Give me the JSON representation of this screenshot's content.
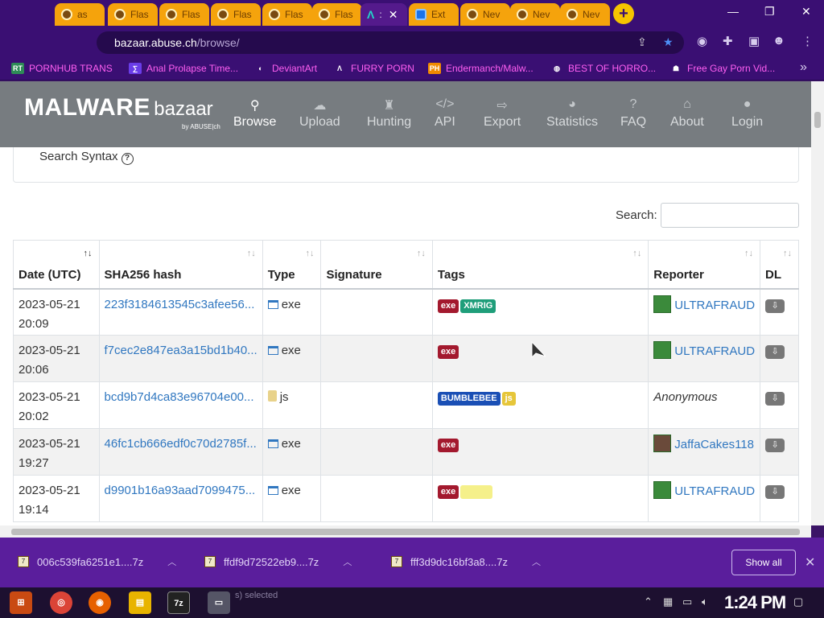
{
  "browser": {
    "tabs": [
      {
        "label": "as",
        "type": "flash"
      },
      {
        "label": "Flas",
        "type": "flash"
      },
      {
        "label": "Flas",
        "type": "flash"
      },
      {
        "label": "Flas",
        "type": "flash"
      },
      {
        "label": "Flas",
        "type": "flash"
      },
      {
        "label": "Flas",
        "type": "flash"
      },
      {
        "label": ":",
        "type": "active",
        "icon": "Λ"
      },
      {
        "label": "Ext",
        "type": "extension"
      },
      {
        "label": "Nev",
        "type": "newtab"
      },
      {
        "label": "Nev",
        "type": "newtab"
      },
      {
        "label": "Nev",
        "type": "newtab"
      }
    ],
    "url_domain": "bazaar.abuse.ch",
    "url_path": "/browse/",
    "bookmarks": [
      {
        "icon": "RT",
        "label": "PORNHUB TRANS",
        "icon_color": "#2e8b57"
      },
      {
        "icon": "∑",
        "label": "Anal Prolapse Time...",
        "icon_color": "#6a3de8"
      },
      {
        "icon": "◐",
        "label": "DeviantArt",
        "icon_color": "#3a0f73"
      },
      {
        "icon": "Λ",
        "label": "FURRY PORN",
        "icon_color": "#3a0f73"
      },
      {
        "icon": "PH",
        "label": "Endermanch/Malw...",
        "icon_color": "#f08a00"
      },
      {
        "icon": "◍",
        "label": "BEST OF HORRO...",
        "icon_color": "#3a0f73"
      },
      {
        "icon": "☗",
        "label": "Free Gay Porn Vid...",
        "icon_color": "#3a0f73"
      }
    ]
  },
  "site": {
    "logo_main": "MALWARE",
    "logo_sub": "bazaar",
    "logo_by": "by ABUSE|ch",
    "nav": [
      {
        "label": "Browse",
        "icon": "search-icon",
        "glyph": "⚲",
        "active": true
      },
      {
        "label": "Upload",
        "icon": "upload-icon",
        "glyph": "☁",
        "active": false
      },
      {
        "label": "Hunting",
        "icon": "hunting-icon",
        "glyph": "♜",
        "active": false
      },
      {
        "label": "API",
        "icon": "code-icon",
        "glyph": "</>",
        "active": false
      },
      {
        "label": "Export",
        "icon": "export-icon",
        "glyph": "⇨",
        "active": false
      },
      {
        "label": "Statistics",
        "icon": "chart-pie-icon",
        "glyph": "◕",
        "active": false
      },
      {
        "label": "FAQ",
        "icon": "question-icon",
        "glyph": "?",
        "active": false
      },
      {
        "label": "About",
        "icon": "building-icon",
        "glyph": "⌂",
        "active": false
      },
      {
        "label": "Login",
        "icon": "user-icon",
        "glyph": "●",
        "active": false
      }
    ],
    "search_syntax": "Search Syntax",
    "search_label": "Search:",
    "search_value": ""
  },
  "table": {
    "headers": [
      "Date (UTC)",
      "SHA256 hash",
      "Type",
      "Signature",
      "Tags",
      "Reporter",
      "DL"
    ],
    "rows": [
      {
        "date": "2023-05-21",
        "time": "20:09",
        "hash": "223f3184613545c3afee56...",
        "type": "exe",
        "signature": "",
        "tags": [
          {
            "text": "exe",
            "color": "#a3192e"
          },
          {
            "text": "XMRIG",
            "color": "#1f9e7a"
          }
        ],
        "reporter": "ULTRAFRAUD",
        "avatar": "green"
      },
      {
        "date": "2023-05-21",
        "time": "20:06",
        "hash": "f7cec2e847ea3a15bd1b40...",
        "type": "exe",
        "signature": "",
        "tags": [
          {
            "text": "exe",
            "color": "#a3192e"
          }
        ],
        "reporter": "ULTRAFRAUD",
        "avatar": "green"
      },
      {
        "date": "2023-05-21",
        "time": "20:02",
        "hash": "bcd9b7d4ca83e96704e00...",
        "type": "js",
        "signature": "",
        "tags": [
          {
            "text": "BUMBLEBEE",
            "color": "#1a4fb5"
          },
          {
            "text": "js",
            "color": "#e6c63a"
          }
        ],
        "reporter": "Anonymous",
        "avatar": "none"
      },
      {
        "date": "2023-05-21",
        "time": "19:27",
        "hash": "46fc1cb666edf0c70d2785f...",
        "type": "exe",
        "signature": "",
        "tags": [
          {
            "text": "exe",
            "color": "#a3192e"
          }
        ],
        "reporter": "JaffaCakes118",
        "avatar": "jaffa"
      },
      {
        "date": "2023-05-21",
        "time": "19:14",
        "hash": "d9901b16a93aad7099475...",
        "type": "exe",
        "signature": "",
        "tags": [
          {
            "text": "exe",
            "color": "#a3192e"
          },
          {
            "text": "",
            "color": "#f5f08a"
          }
        ],
        "reporter": "ULTRAFRAUD",
        "avatar": "green"
      }
    ]
  },
  "downloads": {
    "items": [
      "006c539fa6251e1....7z",
      "ffdf9d72522eb9....7z",
      "fff3d9dc16bf3a8....7z"
    ],
    "show_all": "Show all"
  },
  "taskbar": {
    "status": "s) selected",
    "clock": "1:24 PM"
  }
}
